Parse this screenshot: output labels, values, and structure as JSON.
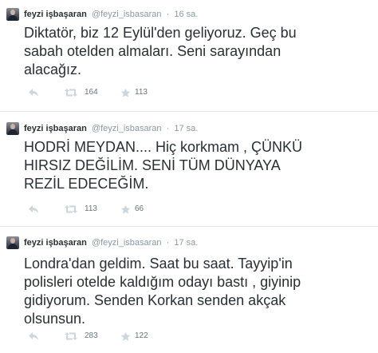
{
  "tweets": [
    {
      "author_name": "feyzi işbaşaran",
      "author_handle": "@feyzi_isbasaran",
      "separator": "·",
      "time": "16 sa.",
      "text": "Diktatör, biz 12 Eylül'den geliyoruz. Geç bu\nsabah otelden almaları. Seni sarayından\nalacağız.",
      "retweets": "164",
      "favorites": "113"
    },
    {
      "author_name": "feyzi işbaşaran",
      "author_handle": "@feyzi_isbasaran",
      "separator": "·",
      "time": "17 sa.",
      "text": "HODRİ MEYDAN.... Hiç korkmam , ÇÜNKÜ\nHIRSIZ DEĞİLİM. SENİ TÜM DÜNYAYA\nREZİL EDECEĞİM.",
      "retweets": "113",
      "favorites": "66"
    },
    {
      "author_name": "feyzi işbaşaran",
      "author_handle": "@feyzi_isbasaran",
      "separator": "·",
      "time": "17 sa.",
      "text": "Londra'dan geldim. Saat bu saat. Tayyip'in\npolisleri otelde kaldığım odayı bastı , giyinip\ngidiyorum. Senden Korkan senden akçak\nolsunsun.",
      "retweets": "283",
      "favorites": "122"
    }
  ],
  "icons": {
    "reply": "reply-icon",
    "retweet": "retweet-icon",
    "favorite": "star-icon"
  },
  "colors": {
    "text": "#292f33",
    "muted": "#8899a6",
    "divider": "#e1e8ed",
    "icon": "#ccd6dd"
  }
}
